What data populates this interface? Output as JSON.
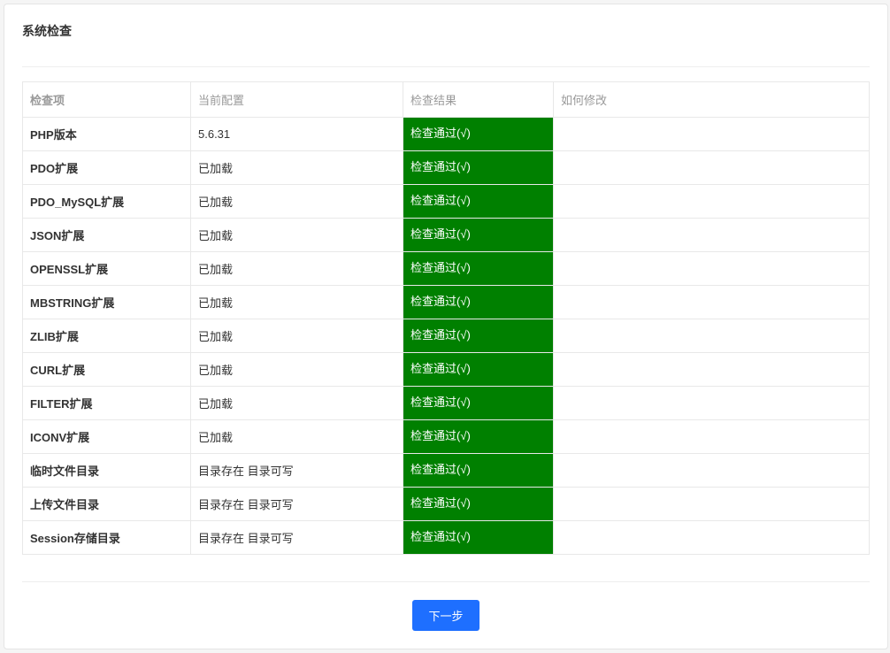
{
  "title": "系统检查",
  "headers": {
    "item": "检查项",
    "config": "当前配置",
    "result": "检查结果",
    "howto": "如何修改"
  },
  "rows": [
    {
      "item": "PHP版本",
      "config": "5.6.31",
      "result": "检查通过(√)",
      "howto": ""
    },
    {
      "item": "PDO扩展",
      "config": "已加载",
      "result": "检查通过(√)",
      "howto": ""
    },
    {
      "item": "PDO_MySQL扩展",
      "config": "已加载",
      "result": "检查通过(√)",
      "howto": ""
    },
    {
      "item": "JSON扩展",
      "config": "已加载",
      "result": "检查通过(√)",
      "howto": ""
    },
    {
      "item": "OPENSSL扩展",
      "config": "已加载",
      "result": "检查通过(√)",
      "howto": ""
    },
    {
      "item": "MBSTRING扩展",
      "config": "已加载",
      "result": "检查通过(√)",
      "howto": ""
    },
    {
      "item": "ZLIB扩展",
      "config": "已加载",
      "result": "检查通过(√)",
      "howto": ""
    },
    {
      "item": "CURL扩展",
      "config": "已加载",
      "result": "检查通过(√)",
      "howto": ""
    },
    {
      "item": "FILTER扩展",
      "config": "已加载",
      "result": "检查通过(√)",
      "howto": ""
    },
    {
      "item": "ICONV扩展",
      "config": "已加载",
      "result": "检查通过(√)",
      "howto": ""
    },
    {
      "item": "临时文件目录",
      "config": "目录存在 目录可写",
      "result": "检查通过(√)",
      "howto": ""
    },
    {
      "item": "上传文件目录",
      "config": "目录存在 目录可写",
      "result": "检查通过(√)",
      "howto": ""
    },
    {
      "item": "Session存储目录",
      "config": "目录存在 目录可写",
      "result": "检查通过(√)",
      "howto": ""
    }
  ],
  "next_label": "下一步"
}
